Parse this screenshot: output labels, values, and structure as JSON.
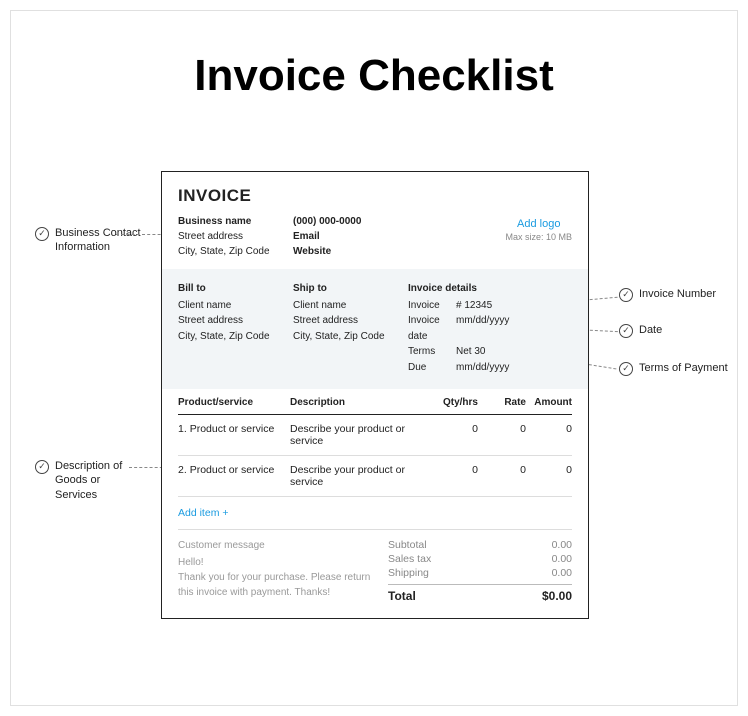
{
  "title": "Invoice Checklist",
  "card": {
    "heading": "INVOICE",
    "business": {
      "name": "Business name",
      "street": "Street address",
      "csz": "City, State, Zip Code"
    },
    "contact": {
      "phone": "(000) 000-0000",
      "email": "Email",
      "website": "Website"
    },
    "logo": {
      "link": "Add logo",
      "sub": "Max size: 10 MB"
    },
    "billto": {
      "heading": "Bill to",
      "name": "Client name",
      "street": "Street address",
      "csz": "City, State, Zip Code"
    },
    "shipto": {
      "heading": "Ship to",
      "name": "Client name",
      "street": "Street address",
      "csz": "City, State, Zip Code"
    },
    "details": {
      "heading": "Invoice details",
      "invoice_k": "Invoice",
      "invoice_v": "# 12345",
      "date_k": "Invoice date",
      "date_v": "mm/dd/yyyy",
      "terms_k": "Terms",
      "terms_v": "Net 30",
      "due_k": "Due",
      "due_v": "mm/dd/yyyy"
    },
    "cols": {
      "prod": "Product/service",
      "desc": "Description",
      "qty": "Qty/hrs",
      "rate": "Rate",
      "amt": "Amount"
    },
    "items": [
      {
        "n": "1.",
        "prod": "Product or service",
        "desc": "Describe your product or service",
        "qty": "0",
        "rate": "0",
        "amt": "0"
      },
      {
        "n": "2.",
        "prod": "Product or service",
        "desc": "Describe your product or service",
        "qty": "0",
        "rate": "0",
        "amt": "0"
      }
    ],
    "add_item": "Add item +",
    "message": {
      "heading": "Customer message",
      "l1": "Hello!",
      "l2": "Thank you for your purchase. Please return this invoice with payment. Thanks!"
    },
    "totals": {
      "subtotal_k": "Subtotal",
      "subtotal_v": "0.00",
      "tax_k": "Sales tax",
      "tax_v": "0.00",
      "ship_k": "Shipping",
      "ship_v": "0.00",
      "total_k": "Total",
      "total_v": "$0.00"
    }
  },
  "callouts": {
    "biz": "Business Contact Information",
    "desc": "Description of Goods or Services",
    "invnum": "Invoice Number",
    "date": "Date",
    "terms": "Terms of Payment"
  }
}
